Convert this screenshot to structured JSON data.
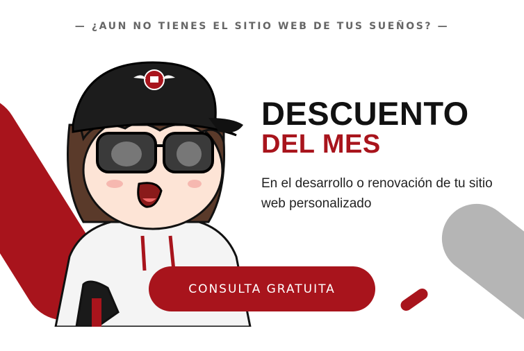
{
  "banner": {
    "kicker": "— ¿AUN NO TIENES EL SITIO WEB DE TUS SUEÑOS? —",
    "headline": "DESCUENTO",
    "subheadline": "DEL MES",
    "description": "En el desarrollo o renovación de tu sitio web personalizado",
    "cta_label": "CONSULTA GRATUITA"
  },
  "mascot": {
    "icon": "cartoon-mascot-illustration"
  },
  "colors": {
    "accent_red": "#a8141c",
    "text_dark": "#111111",
    "deco_grey": "#b5b5b5"
  }
}
